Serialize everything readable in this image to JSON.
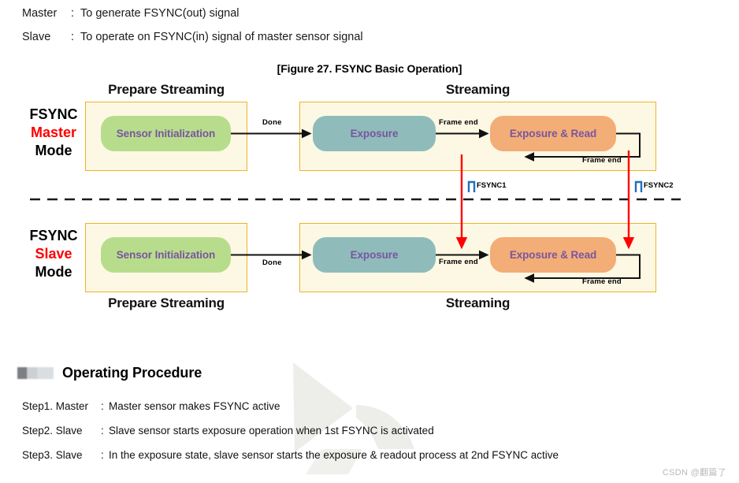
{
  "intro": {
    "rows": [
      {
        "label": "Master",
        "sep": ":",
        "text": "To generate FSYNC(out) signal"
      },
      {
        "label": "Slave",
        "sep": ":",
        "text": "To operate on FSYNC(in) signal of master sensor signal"
      }
    ]
  },
  "figure": {
    "caption": "[Figure 27. FSYNC Basic Operation]",
    "phases": {
      "prepare": "Prepare Streaming",
      "streaming": "Streaming"
    },
    "modes": {
      "master": {
        "line1": "FSYNC",
        "line2": "Master",
        "line3": "Mode"
      },
      "slave": {
        "line1": "FSYNC",
        "line2": "Slave",
        "line3": "Mode"
      }
    },
    "pills": {
      "sensor_init": "Sensor Initialization",
      "exposure": "Exposure",
      "exposure_read": "Exposure & Read"
    },
    "edges": {
      "done": "Done",
      "frame_end": "Frame end",
      "loop_frame_end": "Frame end"
    },
    "fsync": {
      "first": "FSYNC1",
      "second": "FSYNC2"
    },
    "colors": {
      "container_fill": "#fdf8e4",
      "container_border": "#f0b323",
      "green_pill": "#b7dd8c",
      "teal_pill": "#8fbcbb",
      "orange_pill": "#f2ae76",
      "pill_text": "#7a559f",
      "mode_accent": "#ff0000",
      "sync_arrow": "#ff0000",
      "pulse": "#1f6fc4"
    }
  },
  "procedure": {
    "title": "Operating Procedure",
    "steps": [
      {
        "label": "Step1. Master",
        "sep": ":",
        "text": "Master sensor makes FSYNC active"
      },
      {
        "label": "Step2. Slave",
        "sep": ":",
        "text": "Slave sensor starts exposure operation when 1st FSYNC is activated"
      },
      {
        "label": "Step3. Slave",
        "sep": ":",
        "text": "In the exposure state, slave sensor starts the exposure & readout process at 2nd FSYNC active"
      }
    ]
  },
  "watermark": {
    "text": "CSDN @翻篇了"
  }
}
